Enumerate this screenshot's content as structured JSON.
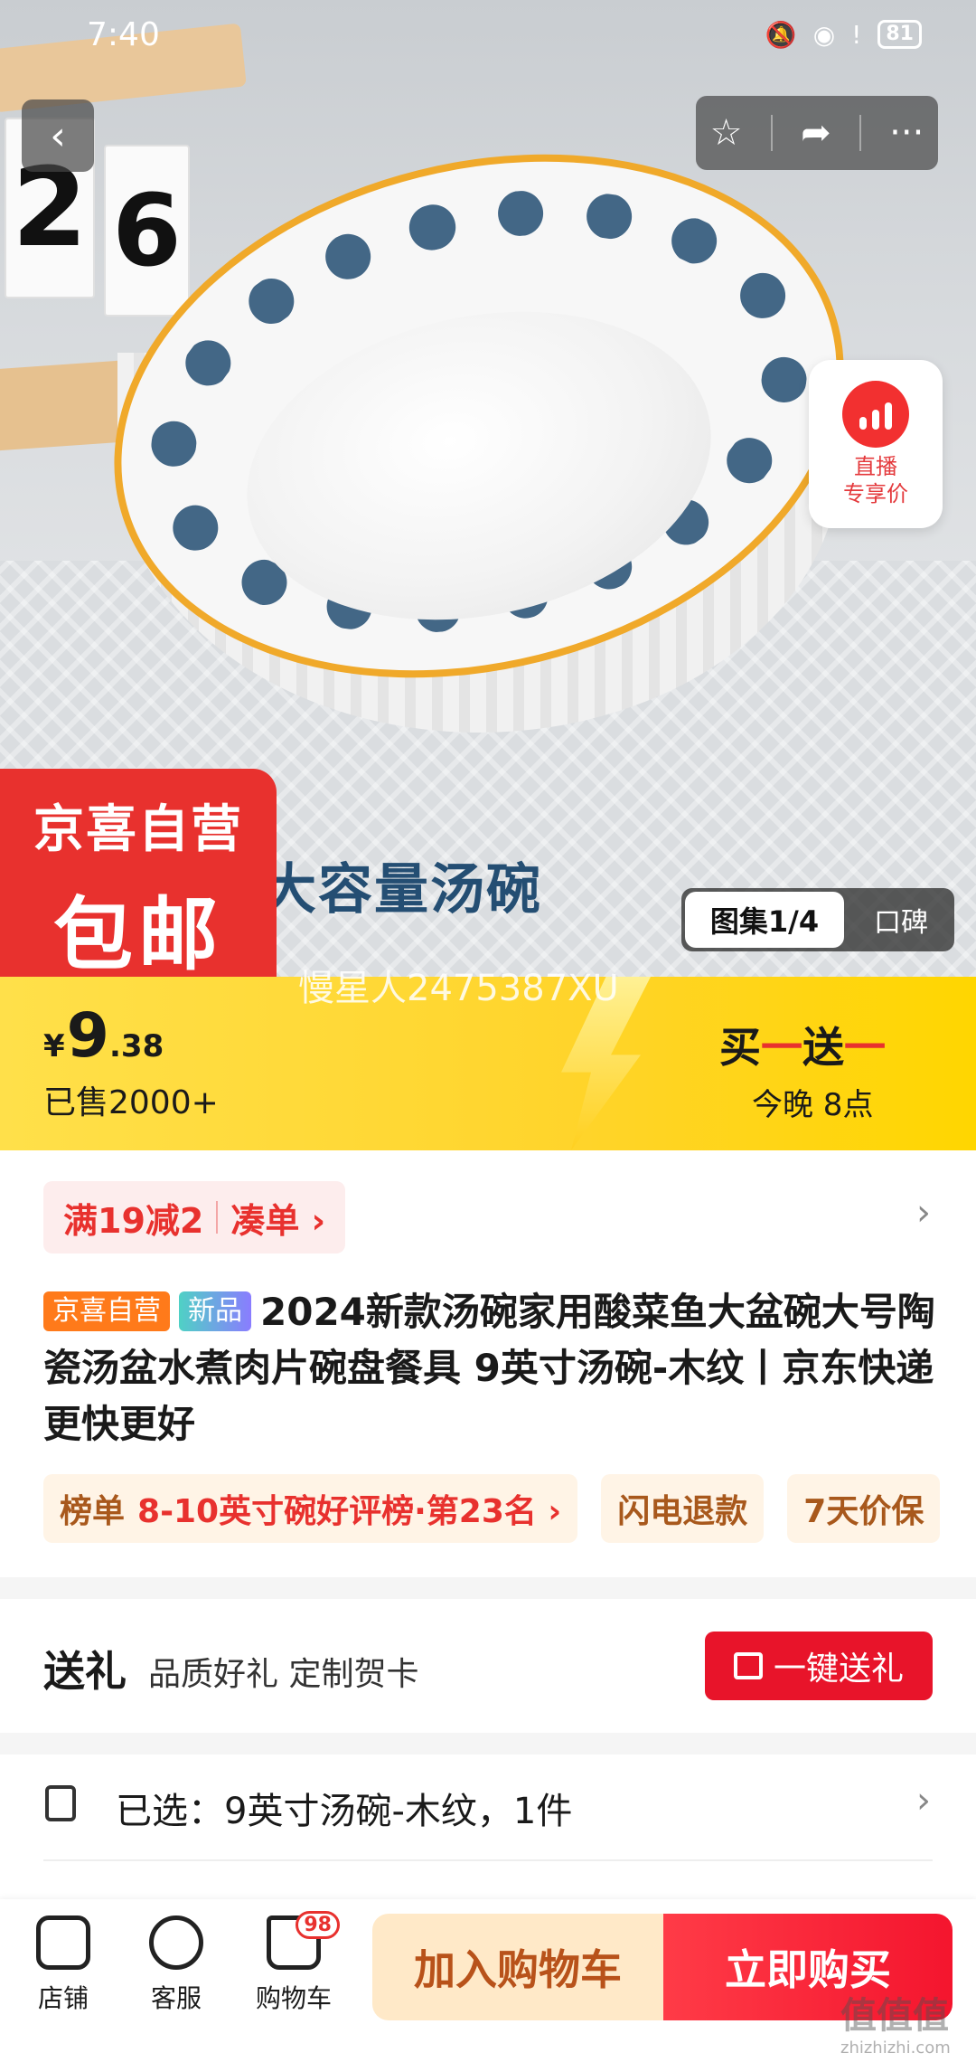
{
  "status": {
    "time": "7:40",
    "battery": "81"
  },
  "hero": {
    "promo_tag_line1": "京喜自营",
    "promo_tag_line2": "包邮",
    "banner_text": "大容量汤碗",
    "calendar_digits": [
      "2",
      "6"
    ],
    "gallery_tab_active": "图集1/4",
    "gallery_tab_other": "口碑",
    "live_badge_line1": "直播",
    "live_badge_line2": "专享价",
    "watermark": "慢星人2475387XU"
  },
  "price": {
    "currency": "¥",
    "integer": "9",
    "decimal": ".38",
    "sold": "已售2000+",
    "bogo_buy": "买",
    "bogo_one": "一",
    "bogo_send": "送",
    "tonight": "今晚 8点"
  },
  "coupon": {
    "discount": "满19减2",
    "combine": "凑单 ›"
  },
  "product": {
    "tag_self": "京喜自营",
    "tag_new": "新品",
    "title": "2024新款汤碗家用酸菜鱼大盆碗大号陶瓷汤盆水煮肉片碗盘餐具 9英寸汤碗-木纹丨京东快递 更快更好"
  },
  "chips": {
    "rank_label": "榜单",
    "rank_value": "8-10英寸碗好评榜·第23名 ›",
    "refund": "闪电退款",
    "price_protect": "7天价保"
  },
  "gift": {
    "label": "送礼",
    "sub": "品质好礼 定制贺卡",
    "button": "一键送礼"
  },
  "selected": {
    "text": "已选：9英寸汤碗-木纹，1件"
  },
  "bottom": {
    "store": "店铺",
    "service": "客服",
    "cart": "购物车",
    "cart_count": "98",
    "add_cart": "加入购物车",
    "buy_now": "立即购买"
  },
  "site_mark": {
    "cn": "值值值",
    "domain": "zhizhizhi.com"
  },
  "colors": {
    "accent_red": "#e8312e",
    "price_yellow": "#ffd42a",
    "cart_btn_bg": "#ffe9c8"
  }
}
